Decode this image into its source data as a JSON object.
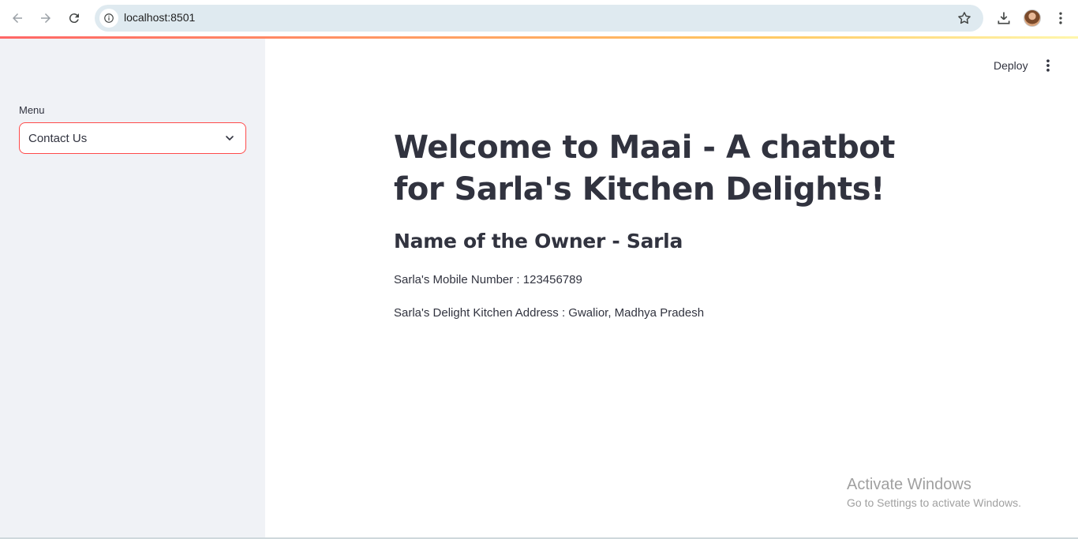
{
  "browser": {
    "url": "localhost:8501"
  },
  "sidebar": {
    "menu_label": "Menu",
    "select_value": "Contact Us"
  },
  "header": {
    "deploy_label": "Deploy"
  },
  "main": {
    "title": "Welcome to Maai - A chatbot for Sarla's Kitchen Delights!",
    "subtitle": "Name of the Owner - Sarla",
    "mobile_line": "Sarla's Mobile Number : 123456789",
    "address_line": "Sarla's Delight Kitchen Address : Gwalior, Madhya Pradesh"
  },
  "watermark": {
    "title": "Activate Windows",
    "subtitle": "Go to Settings to activate Windows."
  },
  "colors": {
    "accent": "#ff4b4b",
    "sidebar_bg": "#f0f2f6",
    "text": "#31333f"
  }
}
